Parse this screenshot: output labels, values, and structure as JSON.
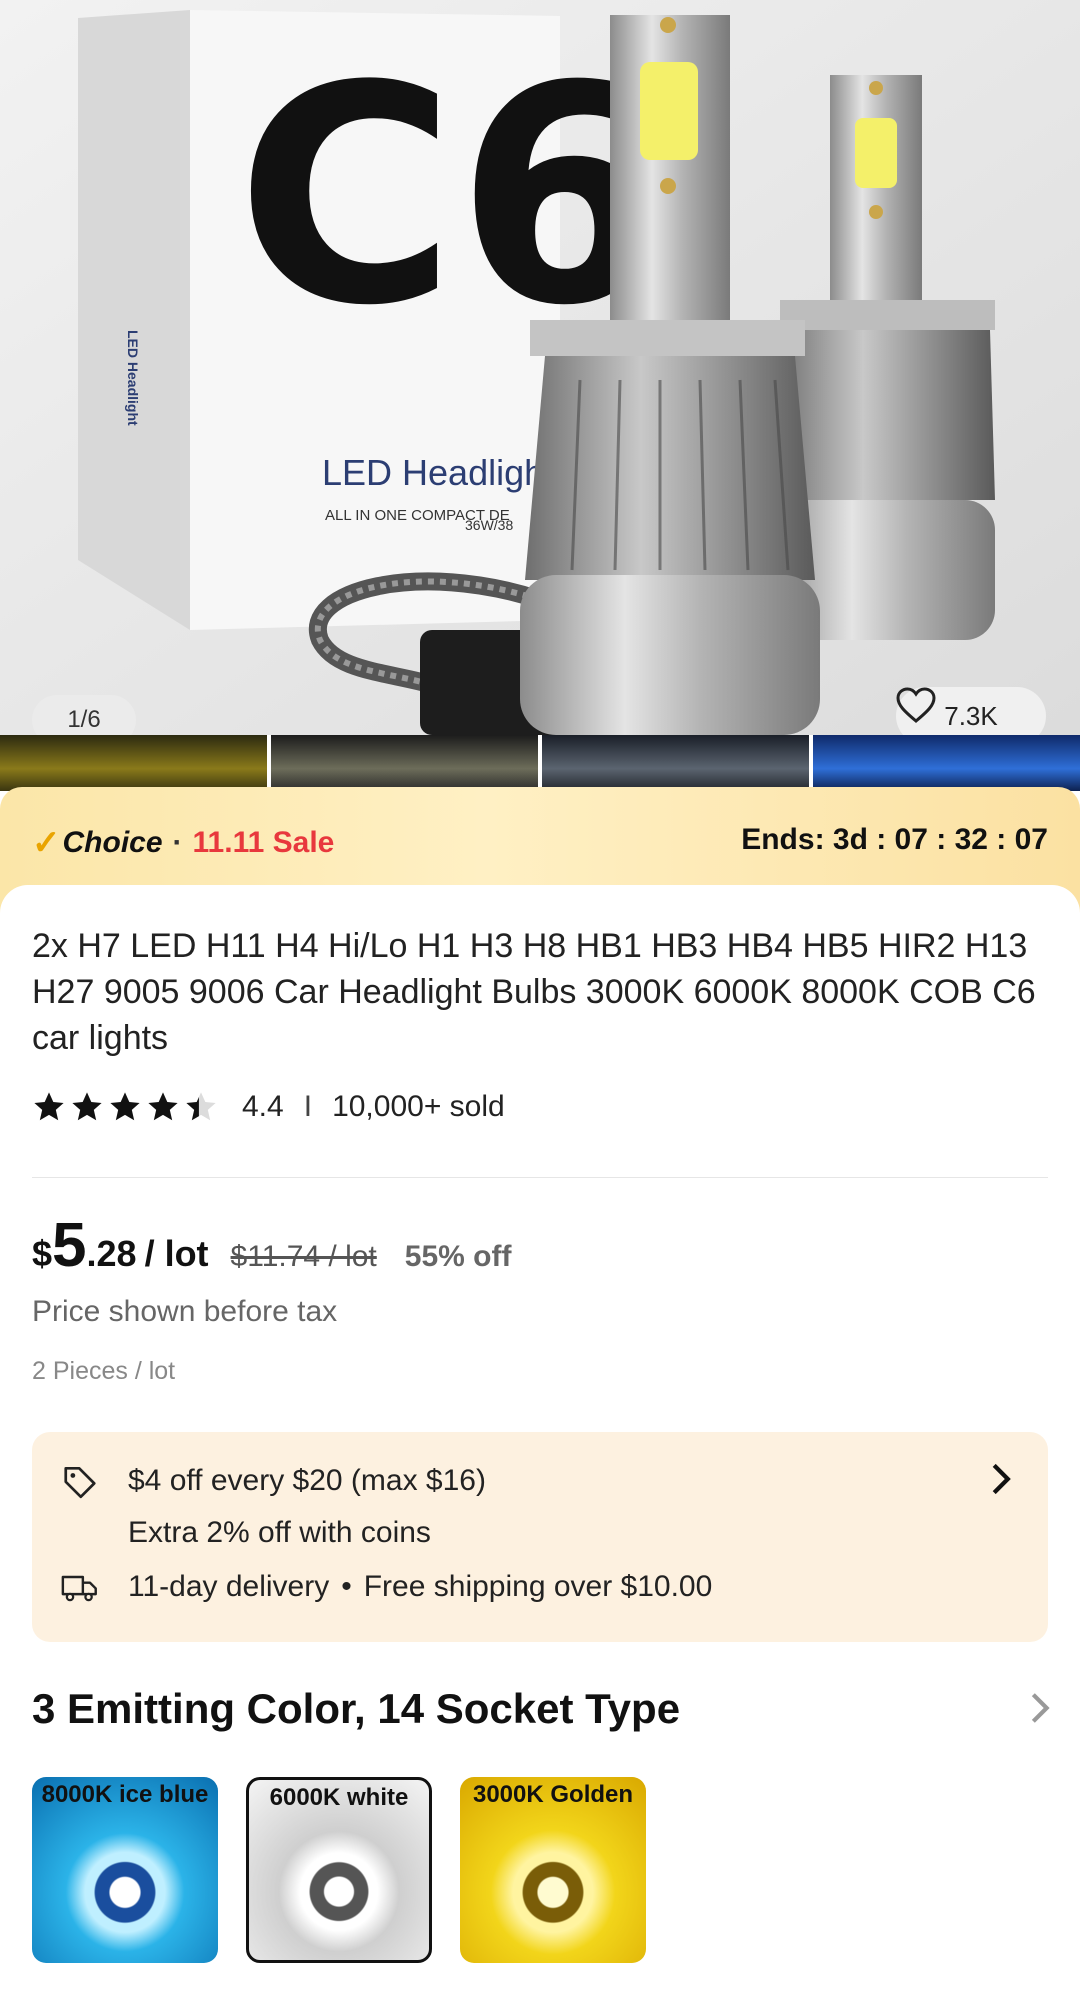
{
  "gallery": {
    "counter": "1/6",
    "likes": "7.3K",
    "box_brand": "C6",
    "box_title": "LED Headligh",
    "box_sub1": "ALL IN ONE COMPACT DE",
    "box_sub2": "36W/38",
    "box_side": "LED Headlight"
  },
  "promo": {
    "choice": "Choice",
    "sale": "11.11 Sale",
    "ends": "Ends: 3d : 07 : 32 : 07"
  },
  "product": {
    "title": "2x H7 LED H11 H4 Hi/Lo H1 H3 H8 HB1 HB3 HB4 HB5 HIR2 H13 H27 9005 9006 Car Headlight Bulbs 3000K 6000K 8000K COB C6 car lights",
    "rating": "4.4",
    "rating_value": 4.4,
    "sold": "10,000+ sold"
  },
  "price": {
    "currency": "$",
    "whole": "5",
    "decimal": ".28",
    "unit": "/ lot",
    "original": "$11.74 / lot",
    "discount": "55% off",
    "tax_note": "Price shown before tax",
    "pieces": "2 Pieces / lot"
  },
  "offers": {
    "coupon": "$4 off every $20 (max $16)",
    "coins": "Extra 2% off with coins",
    "delivery": "11-day delivery",
    "shipping": "Free shipping over $10.00"
  },
  "variants": {
    "heading": "3 Emitting Color, 14 Socket Type",
    "options": [
      {
        "label": "8000K ice blue",
        "color": "#2bb3e8"
      },
      {
        "label": "6000K white",
        "color": "#ededed"
      },
      {
        "label": "3000K Golden",
        "color": "#f2d51a"
      }
    ]
  },
  "colors": {
    "sale_red": "#e8383d",
    "choice_check": "#e9a400",
    "offer_bg": "#fdf1e0"
  }
}
